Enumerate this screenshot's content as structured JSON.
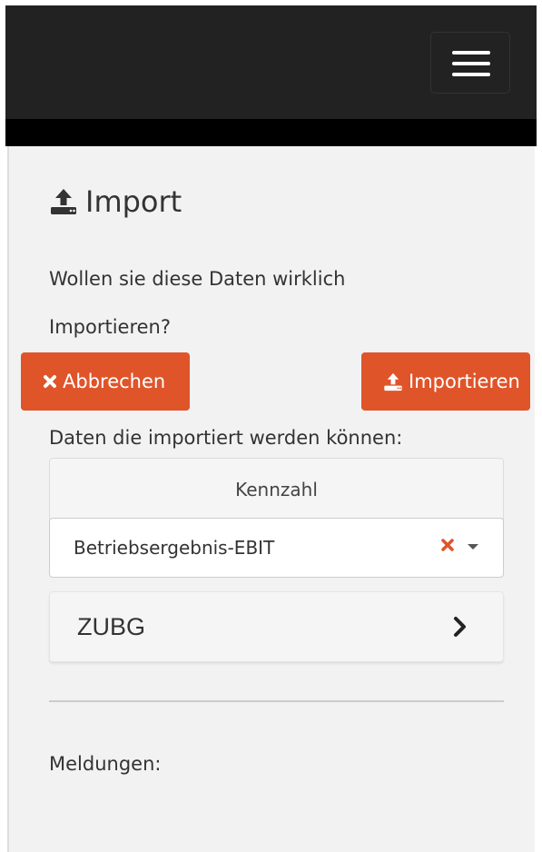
{
  "navbar": {
    "menu_icon": "hamburger-icon",
    "background": "#222222"
  },
  "page": {
    "title": "Import",
    "title_icon": "upload-icon"
  },
  "dialog": {
    "question_line1": "Wollen sie diese Daten wirklich",
    "question_line2": "Importieren?",
    "cancel_label": "Abbrechen",
    "cancel_icon": "close-icon",
    "import_label": "Importieren",
    "import_icon": "upload-icon",
    "accent_color": "#e0542a"
  },
  "data_section": {
    "label": "Daten die importiert werden können:",
    "kennzahl_header": "Kennzahl",
    "kennzahl_selected": "Betriebsergebnis-EBIT",
    "clear_icon": "clear-x-icon",
    "caret_icon": "caret-down-icon",
    "item_label": "ZUBG",
    "item_icon": "chevron-right-icon"
  },
  "messages": {
    "label": "Meldungen:"
  }
}
